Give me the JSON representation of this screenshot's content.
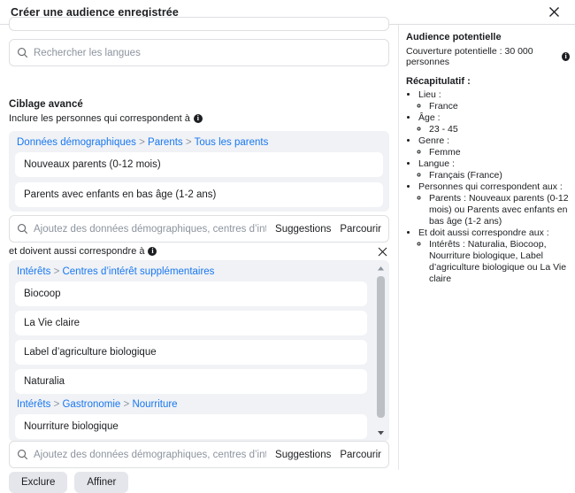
{
  "header": {
    "title": "Créer une audience enregistrée",
    "close_icon": "close-icon"
  },
  "left": {
    "language_search": {
      "placeholder": "Rechercher les langues",
      "icon": "search-icon"
    },
    "advanced_section": {
      "title": "Ciblage avancé",
      "include_label": "Inclure les personnes qui correspondent à",
      "info_icon": "info-icon"
    },
    "include_group": {
      "breadcrumb": [
        "Données démographiques",
        "Parents",
        "Tous les parents"
      ],
      "separator": ">",
      "chips": [
        "Nouveaux parents (0-12 mois)",
        "Parents avec enfants en bas âge (1-2 ans)"
      ]
    },
    "include_search": {
      "placeholder": "Ajoutez des données démographiques, centres d’intérêt ou com",
      "icon": "search-icon",
      "suggestions_label": "Suggestions",
      "browse_label": "Parcourir"
    },
    "and_row": {
      "label": "et doivent aussi correspondre à",
      "info_icon": "info-icon",
      "close_icon": "close-icon"
    },
    "narrow_group": {
      "breadcrumb_1": [
        "Intérêts",
        "Centres d’intérêt supplémentaires"
      ],
      "chips_1": [
        "Biocoop",
        "La Vie claire",
        "Label d’agriculture biologique",
        "Naturalia"
      ],
      "breadcrumb_2": [
        "Intérêts",
        "Gastronomie",
        "Nourriture"
      ],
      "chips_2": [
        "Nourriture biologique"
      ],
      "separator": ">",
      "scroll_up_icon": "chevron-up-icon",
      "scroll_down_icon": "chevron-down-icon"
    },
    "narrow_search": {
      "placeholder": "Ajoutez des données démographiques, centres d’intérêt ou com",
      "icon": "search-icon",
      "suggestions_label": "Suggestions",
      "browse_label": "Parcourir"
    },
    "buttons": {
      "exclude_label": "Exclure",
      "refine_label": "Affiner"
    }
  },
  "right": {
    "audience_title": "Audience potentielle",
    "reach_text": "Couverture potentielle : 30 000 personnes",
    "reach_info_icon": "info-icon",
    "summary_title": "Récapitulatif :",
    "summary": [
      {
        "label": "Lieu :",
        "values": [
          "France"
        ]
      },
      {
        "label": "Âge :",
        "values": [
          "23 - 45"
        ]
      },
      {
        "label": "Genre :",
        "values": [
          "Femme"
        ]
      },
      {
        "label": "Langue :",
        "values": [
          "Français (France)"
        ]
      },
      {
        "label": "Personnes qui correspondent aux :",
        "values": [
          "Parents : Nouveaux parents (0-12 mois) ou Parents avec enfants en bas âge (1-2 ans)"
        ]
      },
      {
        "label": "Et doit aussi correspondre aux :",
        "values": [
          "Intérêts : Naturalia, Biocoop, Nourriture biologique, Label d’agriculture biologique ou La Vie claire"
        ]
      }
    ]
  },
  "colors": {
    "link": "#1877f2",
    "group_bg": "#f0f2f5",
    "button_bg": "#e4e6eb",
    "border": "#dddfe2",
    "placeholder": "#8d949e"
  }
}
